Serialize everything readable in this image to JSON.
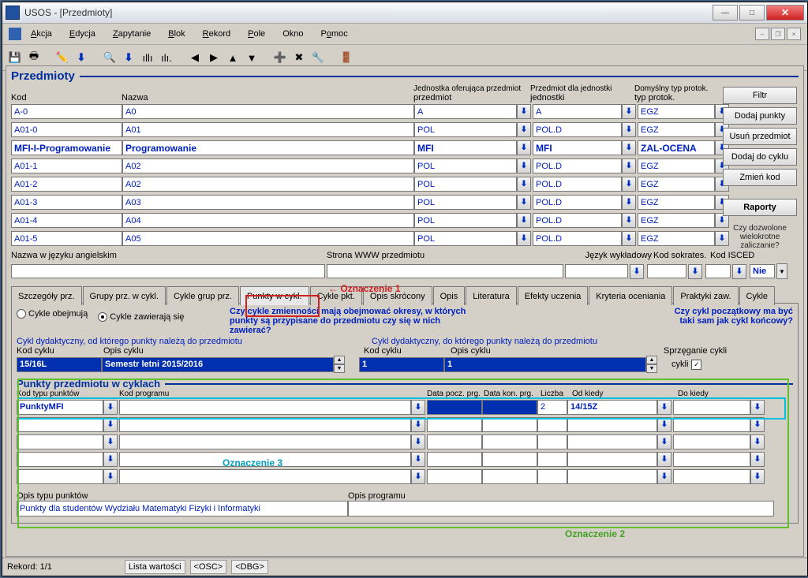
{
  "window": {
    "title": "USOS - [Przedmioty]"
  },
  "menu": {
    "akcja": "Akcja",
    "edycja": "Edycja",
    "zapytanie": "Zapytanie",
    "blok": "Blok",
    "rekord": "Rekord",
    "pole": "Pole",
    "okno": "Okno",
    "pomoc": "Pomoc"
  },
  "section": {
    "title": "Przedmioty"
  },
  "headers": {
    "kod": "Kod",
    "nazwa": "Nazwa",
    "jednostka": "Jednostka oferująca przedmiot",
    "przedmiot_dla": "Przedmiot dla jednostki",
    "typ_protok": "Domyślny typ protok."
  },
  "rows": [
    {
      "kod": "A-0",
      "nazwa": "A0",
      "j": "A",
      "p": "A",
      "t": "EGZ",
      "b": false
    },
    {
      "kod": "A01-0",
      "nazwa": "A01",
      "j": "POL",
      "p": "POL.D",
      "t": "EGZ",
      "b": false
    },
    {
      "kod": "MFI-I-Programowanie",
      "nazwa": "Programowanie",
      "j": "MFI",
      "p": "MFI",
      "t": "ZAL-OCENA",
      "b": true
    },
    {
      "kod": "A01-1",
      "nazwa": "A02",
      "j": "POL",
      "p": "POL.D",
      "t": "EGZ",
      "b": false
    },
    {
      "kod": "A01-2",
      "nazwa": "A02",
      "j": "POL",
      "p": "POL.D",
      "t": "EGZ",
      "b": false
    },
    {
      "kod": "A01-3",
      "nazwa": "A03",
      "j": "POL",
      "p": "POL.D",
      "t": "EGZ",
      "b": false
    },
    {
      "kod": "A01-4",
      "nazwa": "A04",
      "j": "POL",
      "p": "POL.D",
      "t": "EGZ",
      "b": false
    },
    {
      "kod": "A01-5",
      "nazwa": "A05",
      "j": "POL",
      "p": "POL.D",
      "t": "EGZ",
      "b": false
    }
  ],
  "buttons": {
    "filtr": "Filtr",
    "dodaj_punkty": "Dodaj punkty",
    "usun": "Usuń przedmiot",
    "dodaj_cykl": "Dodaj do cyklu",
    "zmien": "Zmień kod",
    "raporty": "Raporty"
  },
  "checknote": "Czy dozwolone wielokrotne zaliczanie?",
  "labels": {
    "nazwa_ang": "Nazwa w języku angielskim",
    "www": "Strona WWW przedmiotu",
    "jezyk": "Język wykładowy",
    "sokrates": "Kod sokrates.",
    "isced": "Kod ISCED"
  },
  "nie": "Nie",
  "tabs": [
    "Szczegóły prz.",
    "Grupy prz. w cykl.",
    "Cykle grup prz.",
    "Punkty w cykl.",
    "Cykle pkt.",
    "Opis skrócony",
    "Opis",
    "Literatura",
    "Efekty uczenia",
    "Kryteria oceniania",
    "Praktyki zaw.",
    "Cykle"
  ],
  "active_tab": 3,
  "panel": {
    "radio1": "Cykle obejmują",
    "radio2": "Cykle zawierają się",
    "q1": "Czy cykle zmienności mają obejmować okresy, w których",
    "q2": "punkty są przypisane do przedmiotu czy się w nich zawierać?",
    "note1": "Czy cykl początkowy ma być",
    "note2": "taki sam jak cykl końcowy?",
    "cykl_od": "Cykl dydaktyczny, od którego punkty należą do przedmiotu",
    "cykl_do": "Cykl dydaktyczny, do którego punkty należą do przedmiotu",
    "kod_cyklu": "Kod cyklu",
    "opis_cyklu": "Opis cyklu",
    "kod_cyklu_v": "15/16L",
    "opis_cyklu_v": "Semestr letni 2015/2016",
    "kod_cyklu2_v": "1",
    "opis_cyklu2_v": "1",
    "sprzeganie": "Sprzęganie cykli"
  },
  "section2": {
    "title": "Punkty przedmiotu w cyklach"
  },
  "head2": {
    "kod_typu": "Kod typu punktów",
    "kod_prog": "Kod programu",
    "data_pocz": "Data pocz. prg.",
    "data_kon": "Data kon. prg.",
    "liczba": "Liczba",
    "od": "Od kiedy",
    "do": "Do kiedy"
  },
  "prow": {
    "kod_typu": "PunktyMFI",
    "liczba": "2",
    "od": "14/15Z"
  },
  "opis_typu": "Opis typu punktów",
  "opis_typu_v": "Punkty dla studentów Wydziału Matematyki Fizyki i Informatyki",
  "opis_prog": "Opis programu",
  "status": {
    "rekord": "Rekord: 1/1",
    "lista": "Lista wartości",
    "osc": "<OSC>",
    "dbg": "<DBG>"
  },
  "anno": {
    "o1": "Oznaczenie 1",
    "o2": "Oznaczenie 2",
    "o3": "Oznaczenie 3"
  }
}
